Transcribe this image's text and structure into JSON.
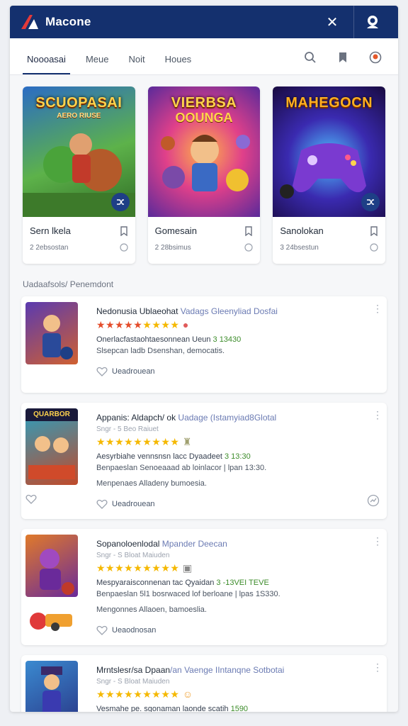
{
  "app": {
    "logo_text": "Macone"
  },
  "tabs": [
    {
      "label": "Noooasai"
    },
    {
      "label": "Meue"
    },
    {
      "label": "Noit"
    },
    {
      "label": "Houes"
    }
  ],
  "featured": [
    {
      "art_title": "SCUOPASAI",
      "art_sub": "AERO RIUSE",
      "name": "Sern lkela",
      "meta": "2  2ebsostan"
    },
    {
      "art_title": "VIERBSA",
      "art_sub": "OOUNGA",
      "name": "Gomesain",
      "meta": "2  28bsimus"
    },
    {
      "art_title": "MAHEGOCN",
      "art_sub": "",
      "name": "Sanolokan",
      "meta": "3  24bsestun"
    }
  ],
  "section_label": "Uadaafsols/ Penemdont",
  "list": [
    {
      "title": "Nedonusia Ublaeohat ",
      "title_accent": "Vadags Gleenyliad Dosfai",
      "subtitle": "",
      "stars": "★★★★★★★★★",
      "desc": "Onerlacfastaohtaesonnean Ueun ",
      "price": "3 13430",
      "desc2": "Slsepcan ladb Dsenshan, democatis.",
      "action": "Ueadrouean",
      "thumb_text": ""
    },
    {
      "title": "Appanis: Aldapch/ ok ",
      "title_accent": "Uadage (Istamyiad8Glotal",
      "subtitle": "Sngr - 5 Beo Raiuet",
      "stars": "★★★★★★★★★",
      "desc": "Aesyrbiahe vennsnsn lacc Dyaadeet ",
      "price": "3 13:30",
      "desc2": "Benpaeslan Senoeaaad ab loinlacor | lpan 13:30.",
      "desc3": "Menpenaes Alladeny bumoesia.",
      "action": "Ueadrouean",
      "thumb_text": "QUARBOR"
    },
    {
      "title": "Sopanoloenlodal ",
      "title_accent": "Mpander Deecan",
      "subtitle": "Sngr - S Bloat Maiuden",
      "stars": "★★★★★★★★★",
      "desc": "Mespyaraisconnenan tac Qyaidan ",
      "price": "3 -13VEI TEVE",
      "desc2": "Benpaeslan 5l1 bosrwaced lof berloane | lpas 1S330.",
      "desc3": "Mengonnes Allaoen, bamoeslia.",
      "action": "Ueaodnosan",
      "thumb_text": ""
    },
    {
      "title": "Mrntslesr/sa Dpaan",
      "title_accent": "/an Vaenge IIntanqne Sotbotai",
      "subtitle": "Sngr - S Bloat Maiuden",
      "stars": "★★★★★★★★★",
      "desc": "Vesmahe pe. sgonaman laonde scatih ",
      "price": "1590",
      "desc2": "",
      "action": "",
      "thumb_text": ""
    }
  ],
  "colors": {
    "primary": "#14306e",
    "star": "#f5b800",
    "price": "#3c8c2a"
  }
}
